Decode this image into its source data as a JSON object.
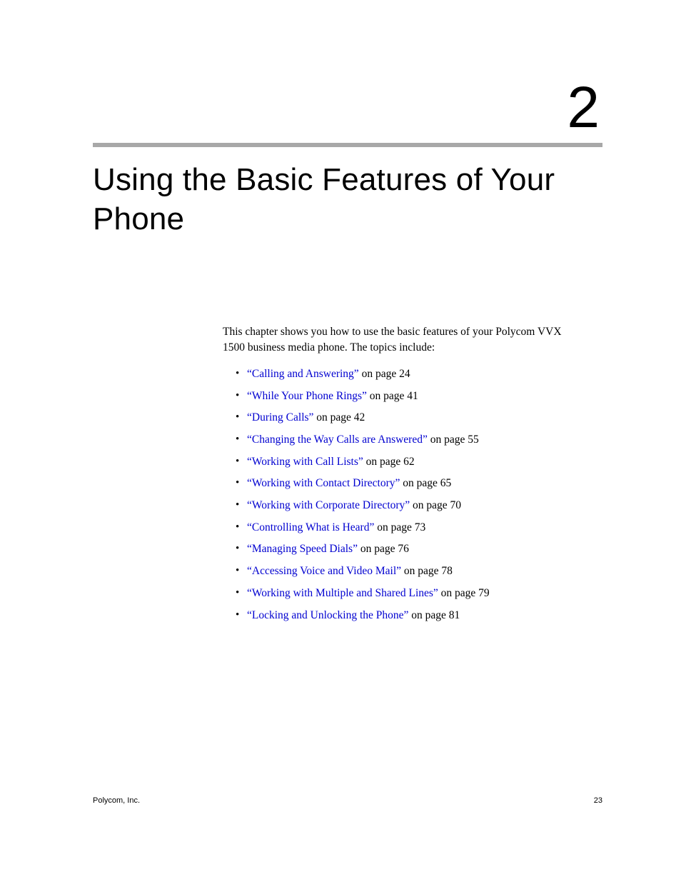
{
  "chapter": {
    "number": "2",
    "title": "Using the Basic Features of Your Phone"
  },
  "intro": "This chapter shows you how to use the basic features of your Polycom VVX 1500 business media phone. The topics include:",
  "topics": [
    {
      "link": "“Calling and Answering”",
      "suffix": " on page 24"
    },
    {
      "link": "“While Your Phone Rings”",
      "suffix": " on page 41"
    },
    {
      "link": "“During Calls”",
      "suffix": " on page 42"
    },
    {
      "link": "“Changing the Way Calls are Answered”",
      "suffix": " on page 55"
    },
    {
      "link": "“Working with Call Lists”",
      "suffix": " on page 62"
    },
    {
      "link": "“Working with Contact Directory”",
      "suffix": " on page 65"
    },
    {
      "link": "“Working with Corporate Directory”",
      "suffix": " on page 70"
    },
    {
      "link": "“Controlling What is Heard”",
      "suffix": " on page 73"
    },
    {
      "link": "“Managing Speed Dials”",
      "suffix": " on page 76"
    },
    {
      "link": "“Accessing Voice and Video Mail”",
      "suffix": " on page 78"
    },
    {
      "link": "“Working with Multiple and Shared Lines”",
      "suffix": " on page 79"
    },
    {
      "link": "“Locking and Unlocking the Phone”",
      "suffix": " on page 81"
    }
  ],
  "footer": {
    "left": "Polycom, Inc.",
    "right": "23"
  }
}
